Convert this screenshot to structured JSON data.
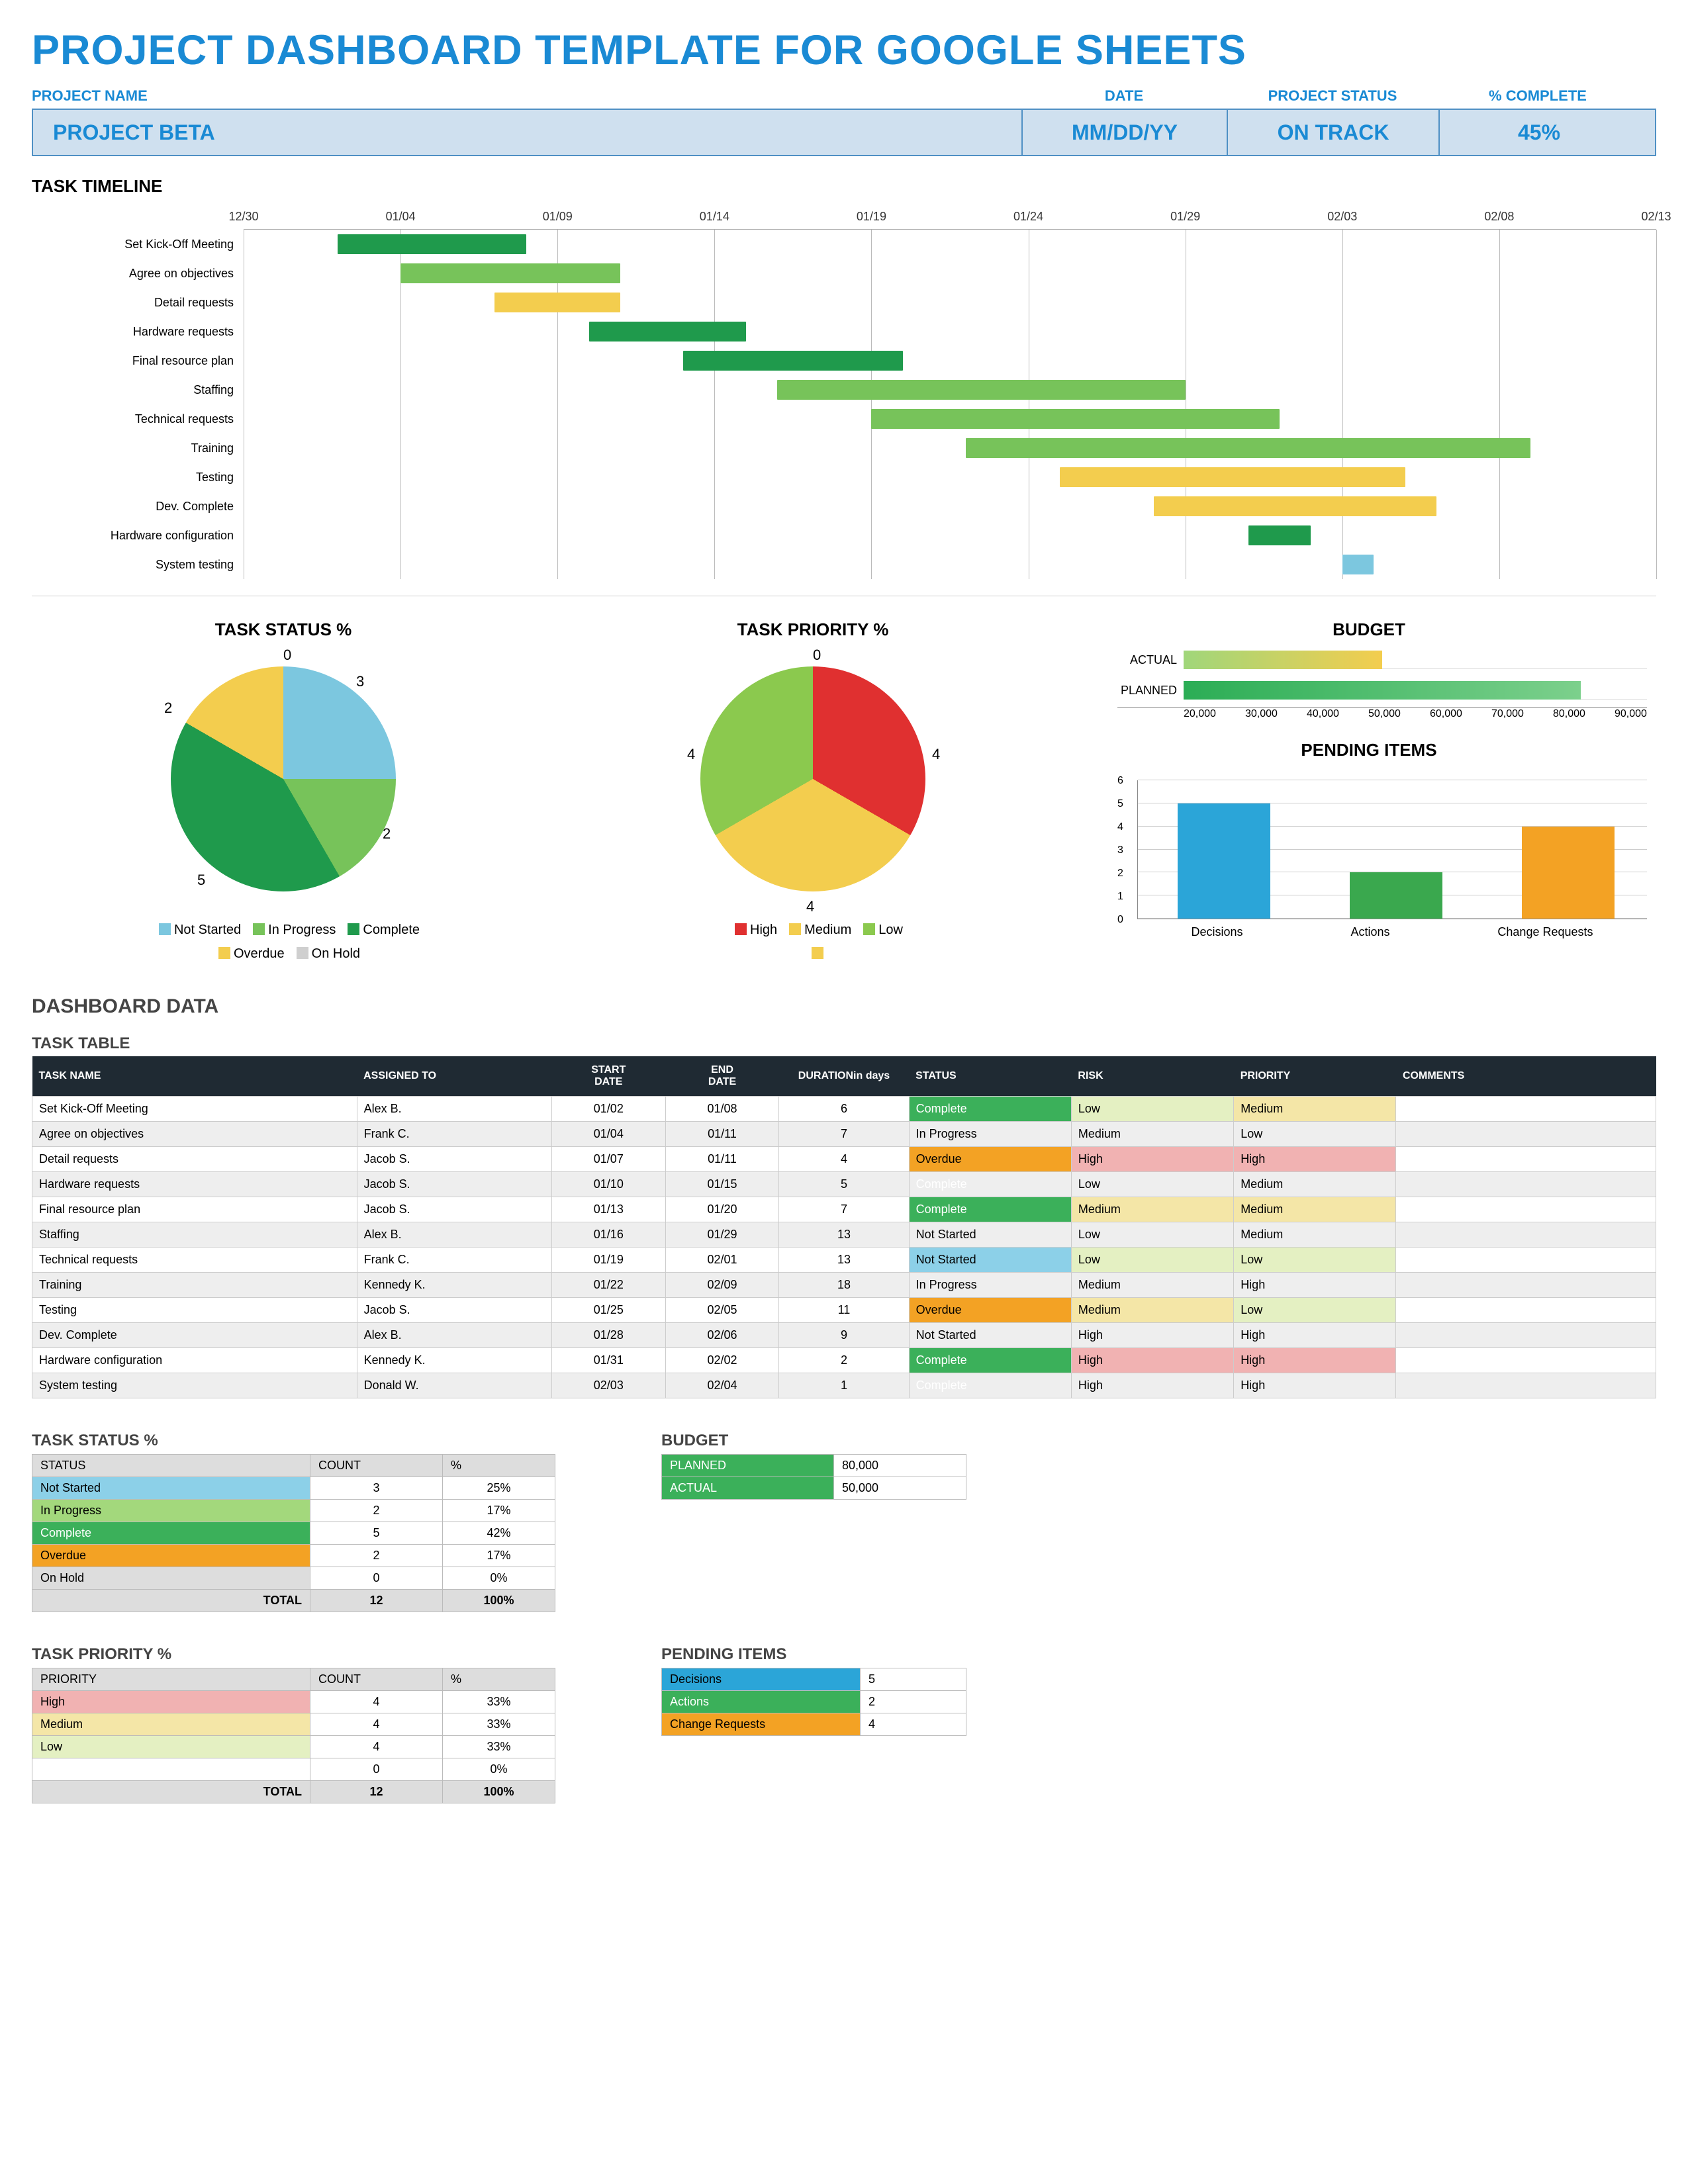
{
  "main_title": "PROJECT DASHBOARD TEMPLATE FOR GOOGLE SHEETS",
  "header": {
    "labels": {
      "project_name": "PROJECT NAME",
      "date": "DATE",
      "status": "PROJECT  STATUS",
      "complete": "% COMPLETE"
    },
    "values": {
      "project_name": "PROJECT BETA",
      "date": "MM/DD/YY",
      "status": "ON TRACK",
      "complete": "45%"
    }
  },
  "section_titles": {
    "timeline": "TASK TIMELINE",
    "task_status": "TASK STATUS %",
    "task_priority": "TASK PRIORITY %",
    "budget": "BUDGET",
    "pending": "PENDING ITEMS",
    "dashboard_data": "DASHBOARD DATA",
    "task_table": "TASK TABLE",
    "task_status2": "TASK STATUS %",
    "budget2": "BUDGET",
    "task_priority2": "TASK PRIORITY %",
    "pending2": "PENDING ITEMS"
  },
  "colors": {
    "complete": "#1f9a4c",
    "inprogress": "#77c35a",
    "notstarted": "#7cc7df",
    "overdue": "#f3cd4e",
    "onhold": "#cfcfcf",
    "high": "#e03030",
    "medium": "#f3cd4e",
    "low": "#8bc94e",
    "budget_actual_from": "#a0d67a",
    "budget_actual_to": "#f3cd4e",
    "budget_planned_from": "#2bad55",
    "budget_planned_to": "#7cd08c",
    "pending_decisions": "#2ba5d8",
    "pending_actions": "#3aa84e",
    "pending_changes": "#f3a224"
  },
  "chart_data": [
    {
      "name": "task_timeline",
      "type": "gantt",
      "x_ticks": [
        "12/30",
        "01/04",
        "01/09",
        "01/14",
        "01/19",
        "01/24",
        "01/29",
        "02/03",
        "02/08",
        "02/13"
      ],
      "x_start": "12/30",
      "x_end": "02/13",
      "tasks": [
        {
          "label": "Set Kick-Off Meeting",
          "start": "01/02",
          "end": "01/08",
          "color": "#1f9a4c"
        },
        {
          "label": "Agree on objectives",
          "start": "01/04",
          "end": "01/11",
          "color": "#77c35a"
        },
        {
          "label": "Detail requests",
          "start": "01/07",
          "end": "01/11",
          "color": "#f3cd4e"
        },
        {
          "label": "Hardware requests",
          "start": "01/10",
          "end": "01/15",
          "color": "#1f9a4c"
        },
        {
          "label": "Final resource plan",
          "start": "01/13",
          "end": "01/20",
          "color": "#1f9a4c"
        },
        {
          "label": "Staffing",
          "start": "01/16",
          "end": "01/29",
          "color": "#77c35a"
        },
        {
          "label": "Technical requests",
          "start": "01/19",
          "end": "02/01",
          "color": "#77c35a"
        },
        {
          "label": "Training",
          "start": "01/22",
          "end": "02/09",
          "color": "#77c35a"
        },
        {
          "label": "Testing",
          "start": "01/25",
          "end": "02/05",
          "color": "#f3cd4e"
        },
        {
          "label": "Dev. Complete",
          "start": "01/28",
          "end": "02/06",
          "color": "#f3cd4e"
        },
        {
          "label": "Hardware configuration",
          "start": "01/31",
          "end": "02/02",
          "color": "#1f9a4c"
        },
        {
          "label": "System testing",
          "start": "02/03",
          "end": "02/04",
          "color": "#7cc7df"
        }
      ]
    },
    {
      "name": "task_status_pie",
      "type": "pie",
      "title": "TASK STATUS %",
      "series": [
        {
          "name": "Not Started",
          "value": 3,
          "color": "#7cc7df"
        },
        {
          "name": "In Progress",
          "value": 2,
          "color": "#77c35a"
        },
        {
          "name": "Complete",
          "value": 5,
          "color": "#1f9a4c"
        },
        {
          "name": "Overdue",
          "value": 2,
          "color": "#f3cd4e"
        },
        {
          "name": "On Hold",
          "value": 0,
          "color": "#cfcfcf"
        }
      ],
      "legend": [
        "Not Started",
        "In Progress",
        "Complete",
        "Overdue",
        "On Hold"
      ]
    },
    {
      "name": "task_priority_pie",
      "type": "pie",
      "title": "TASK PRIORITY %",
      "series": [
        {
          "name": "High",
          "value": 4,
          "color": "#e03030"
        },
        {
          "name": "Medium",
          "value": 4,
          "color": "#f3cd4e"
        },
        {
          "name": "Low",
          "value": 4,
          "color": "#8bc94e"
        },
        {
          "name": "",
          "value": 0,
          "color": "#f3cd4e"
        }
      ],
      "legend": [
        "High",
        "Medium",
        "Low",
        ""
      ]
    },
    {
      "name": "budget_bar",
      "type": "bar",
      "title": "BUDGET",
      "orientation": "horizontal",
      "categories": [
        "ACTUAL",
        "PLANNED"
      ],
      "values": [
        50000,
        80000
      ],
      "x_ticks": [
        20000,
        30000,
        40000,
        50000,
        60000,
        70000,
        80000,
        90000
      ],
      "xlim": [
        20000,
        90000
      ]
    },
    {
      "name": "pending_bar",
      "type": "bar",
      "title": "PENDING ITEMS",
      "categories": [
        "Decisions",
        "Actions",
        "Change Requests"
      ],
      "values": [
        5,
        2,
        4
      ],
      "colors": [
        "#2ba5d8",
        "#3aa84e",
        "#f3a224"
      ],
      "y_ticks": [
        0,
        1,
        2,
        3,
        4,
        5,
        6
      ],
      "ylim": [
        0,
        6
      ]
    }
  ],
  "task_table": {
    "headers": [
      "TASK NAME",
      "ASSIGNED TO",
      "START DATE",
      "END DATE",
      "DURATION in days",
      "STATUS",
      "RISK",
      "PRIORITY",
      "COMMENTS"
    ],
    "rows": [
      {
        "name": "Set Kick-Off Meeting",
        "assigned": "Alex B.",
        "start": "01/02",
        "end": "01/08",
        "dur": "6",
        "status": "Complete",
        "risk": "Low",
        "priority": "Medium",
        "comments": ""
      },
      {
        "name": "Agree on objectives",
        "assigned": "Frank C.",
        "start": "01/04",
        "end": "01/11",
        "dur": "7",
        "status": "In Progress",
        "risk": "Medium",
        "priority": "Low",
        "comments": ""
      },
      {
        "name": "Detail requests",
        "assigned": "Jacob S.",
        "start": "01/07",
        "end": "01/11",
        "dur": "4",
        "status": "Overdue",
        "risk": "High",
        "priority": "High",
        "comments": ""
      },
      {
        "name": "Hardware requests",
        "assigned": "Jacob S.",
        "start": "01/10",
        "end": "01/15",
        "dur": "5",
        "status": "Complete",
        "risk": "Low",
        "priority": "Medium",
        "comments": ""
      },
      {
        "name": "Final resource plan",
        "assigned": "Jacob S.",
        "start": "01/13",
        "end": "01/20",
        "dur": "7",
        "status": "Complete",
        "risk": "Medium",
        "priority": "Medium",
        "comments": ""
      },
      {
        "name": "Staffing",
        "assigned": "Alex B.",
        "start": "01/16",
        "end": "01/29",
        "dur": "13",
        "status": "Not Started",
        "risk": "Low",
        "priority": "Medium",
        "comments": ""
      },
      {
        "name": "Technical requests",
        "assigned": "Frank C.",
        "start": "01/19",
        "end": "02/01",
        "dur": "13",
        "status": "Not Started",
        "risk": "Low",
        "priority": "Low",
        "comments": ""
      },
      {
        "name": "Training",
        "assigned": "Kennedy K.",
        "start": "01/22",
        "end": "02/09",
        "dur": "18",
        "status": "In Progress",
        "risk": "Medium",
        "priority": "High",
        "comments": ""
      },
      {
        "name": "Testing",
        "assigned": "Jacob S.",
        "start": "01/25",
        "end": "02/05",
        "dur": "11",
        "status": "Overdue",
        "risk": "Medium",
        "priority": "Low",
        "comments": ""
      },
      {
        "name": "Dev. Complete",
        "assigned": "Alex B.",
        "start": "01/28",
        "end": "02/06",
        "dur": "9",
        "status": "Not Started",
        "risk": "High",
        "priority": "High",
        "comments": ""
      },
      {
        "name": "Hardware configuration",
        "assigned": "Kennedy K.",
        "start": "01/31",
        "end": "02/02",
        "dur": "2",
        "status": "Complete",
        "risk": "High",
        "priority": "High",
        "comments": ""
      },
      {
        "name": "System testing",
        "assigned": "Donald W.",
        "start": "02/03",
        "end": "02/04",
        "dur": "1",
        "status": "Complete",
        "risk": "High",
        "priority": "High",
        "comments": ""
      }
    ]
  },
  "status_summary": {
    "headers": [
      "STATUS",
      "COUNT",
      "%"
    ],
    "rows": [
      {
        "label": "Not Started",
        "count": "3",
        "pct": "25%",
        "class": "c-notstarted"
      },
      {
        "label": "In Progress",
        "count": "2",
        "pct": "17%",
        "class": "c-inprogress"
      },
      {
        "label": "Complete",
        "count": "5",
        "pct": "42%",
        "class": "c-complete"
      },
      {
        "label": "Overdue",
        "count": "2",
        "pct": "17%",
        "class": "c-overdue"
      },
      {
        "label": "On Hold",
        "count": "0",
        "pct": "0%",
        "class": "c-onhold"
      }
    ],
    "total_label": "TOTAL",
    "total_count": "12",
    "total_pct": "100%"
  },
  "priority_summary": {
    "headers": [
      "PRIORITY",
      "COUNT",
      "%"
    ],
    "rows": [
      {
        "label": "High",
        "count": "4",
        "pct": "33%",
        "class": "c-high"
      },
      {
        "label": "Medium",
        "count": "4",
        "pct": "33%",
        "class": "c-medium"
      },
      {
        "label": "Low",
        "count": "4",
        "pct": "33%",
        "class": "c-low"
      },
      {
        "label": "",
        "count": "0",
        "pct": "0%",
        "class": ""
      }
    ],
    "total_label": "TOTAL",
    "total_count": "12",
    "total_pct": "100%"
  },
  "budget_summary": {
    "rows": [
      {
        "label": "PLANNED",
        "value": "80,000",
        "class": "c-complete"
      },
      {
        "label": "ACTUAL",
        "value": "50,000",
        "class": "c-complete"
      }
    ]
  },
  "pending_summary": {
    "rows": [
      {
        "label": "Decisions",
        "value": "5",
        "class": "c-bluebar"
      },
      {
        "label": "Actions",
        "value": "2",
        "class": "c-complete"
      },
      {
        "label": "Change Requests",
        "value": "4",
        "class": "c-orange"
      }
    ]
  }
}
